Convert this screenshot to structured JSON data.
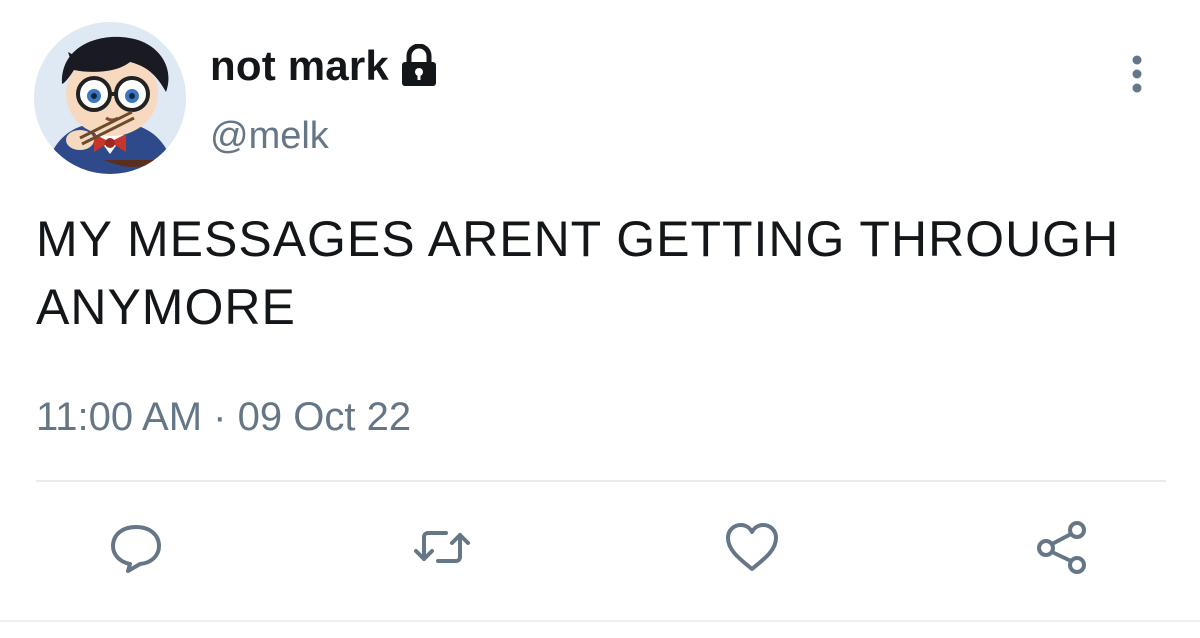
{
  "user": {
    "display_name": "not mark",
    "handle": "@melk",
    "protected": true
  },
  "tweet": {
    "text": "MY MESSAGES ARENT GETTING THROUGH ANYMORE",
    "time": "11:00 AM",
    "separator": "·",
    "date": "09 Oct 22"
  },
  "icons": {
    "lock": "lock-icon",
    "more": "more-vertical-icon",
    "reply": "reply-icon",
    "retweet": "retweet-icon",
    "like": "heart-icon",
    "share": "share-icon"
  },
  "colors": {
    "text": "#14171a",
    "secondary": "#657786",
    "divider": "#e6ecf0"
  }
}
